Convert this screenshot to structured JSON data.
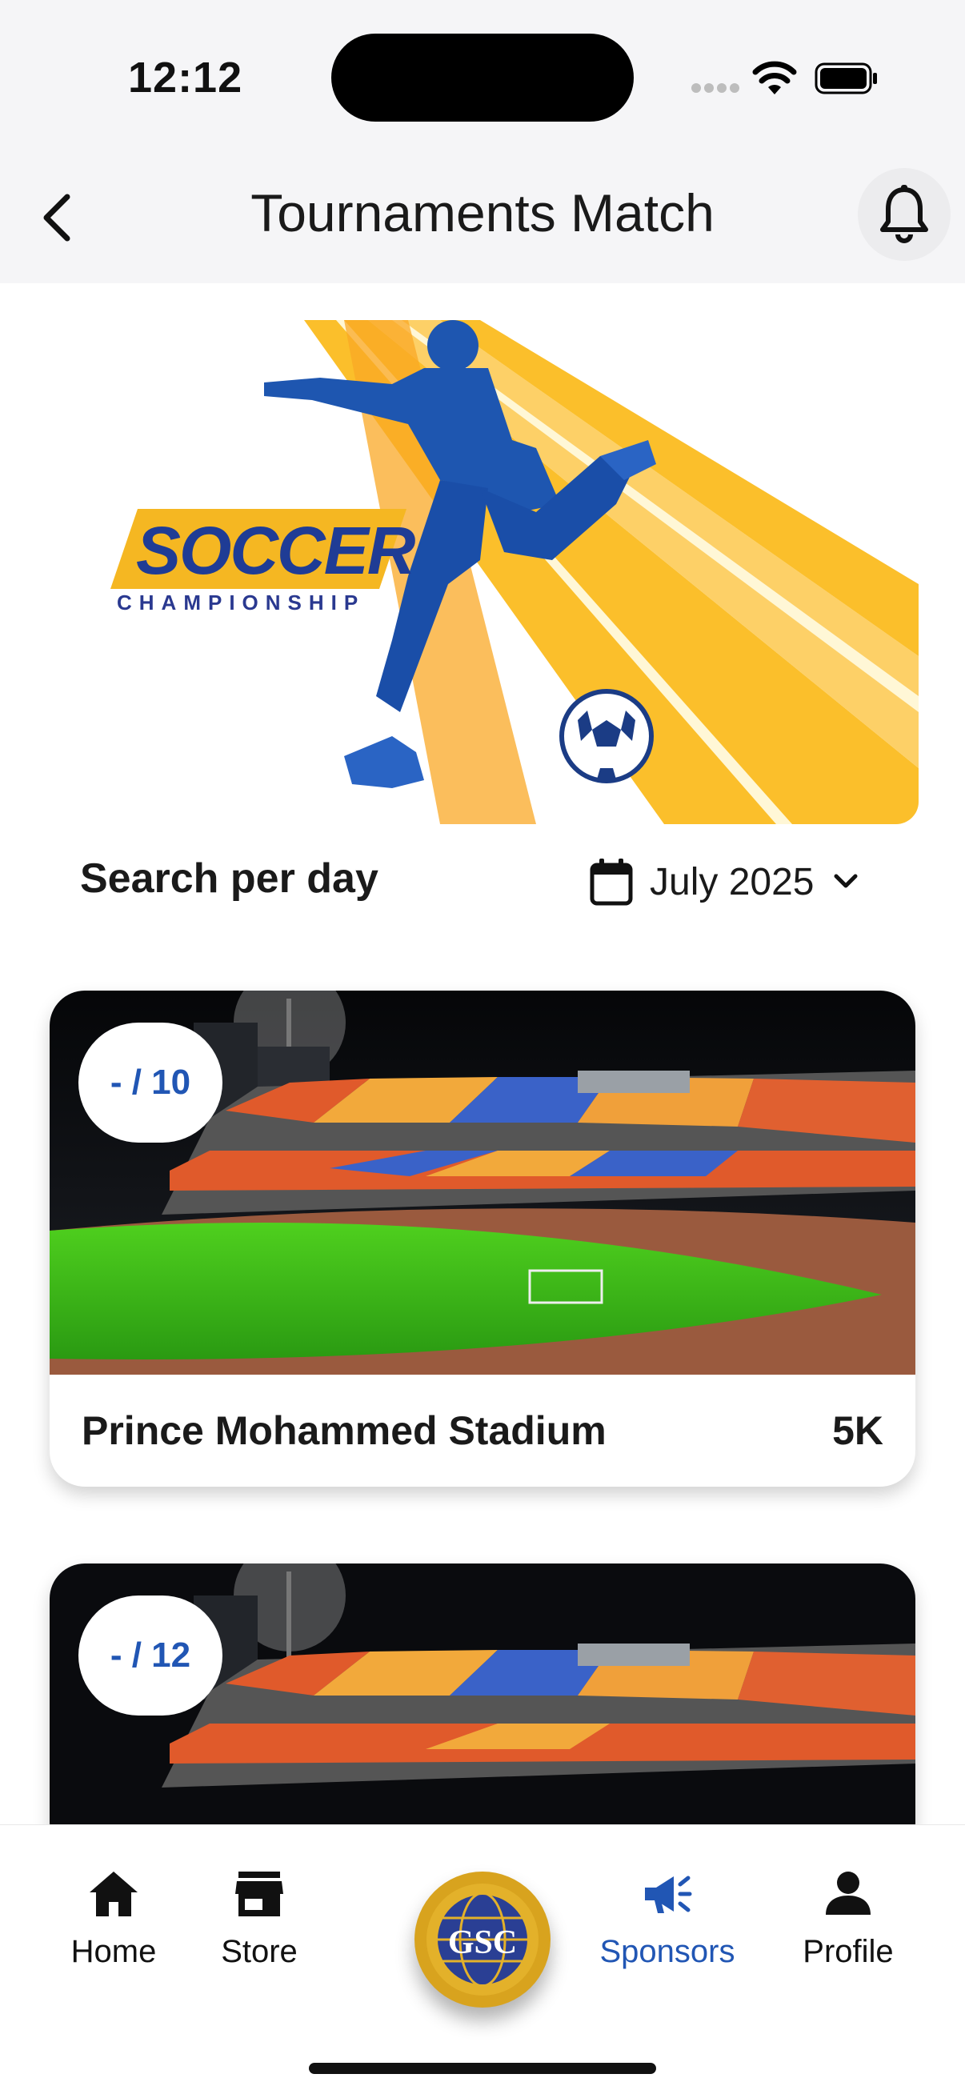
{
  "status_bar": {
    "time": "12:12"
  },
  "header": {
    "title": "Tournaments Match",
    "back_icon": "chevron-left-icon",
    "bell_icon": "bell-icon"
  },
  "banner": {
    "logo_text": "SOCCER",
    "logo_subtext": "CHAMPIONSHIP"
  },
  "search": {
    "label": "Search per day",
    "date_value": "July 2025",
    "calendar_icon": "calendar-icon",
    "dropdown_icon": "chevron-down-icon"
  },
  "matches": [
    {
      "count": "- / 10",
      "name": "Prince Mohammed Stadium",
      "capacity": "5K"
    },
    {
      "count": "- / 12"
    }
  ],
  "bottom_nav": {
    "items": [
      {
        "label": "Home",
        "icon": "home-icon"
      },
      {
        "label": "Store",
        "icon": "store-icon"
      },
      {
        "label": "Sponsors",
        "icon": "megaphone-icon",
        "active": true
      },
      {
        "label": "Profile",
        "icon": "person-icon"
      }
    ],
    "center_logo": "GSC"
  },
  "colors": {
    "accent": "#2156b4",
    "header_bg": "#f5f5f7",
    "logo_gold": "#d8a31e"
  }
}
